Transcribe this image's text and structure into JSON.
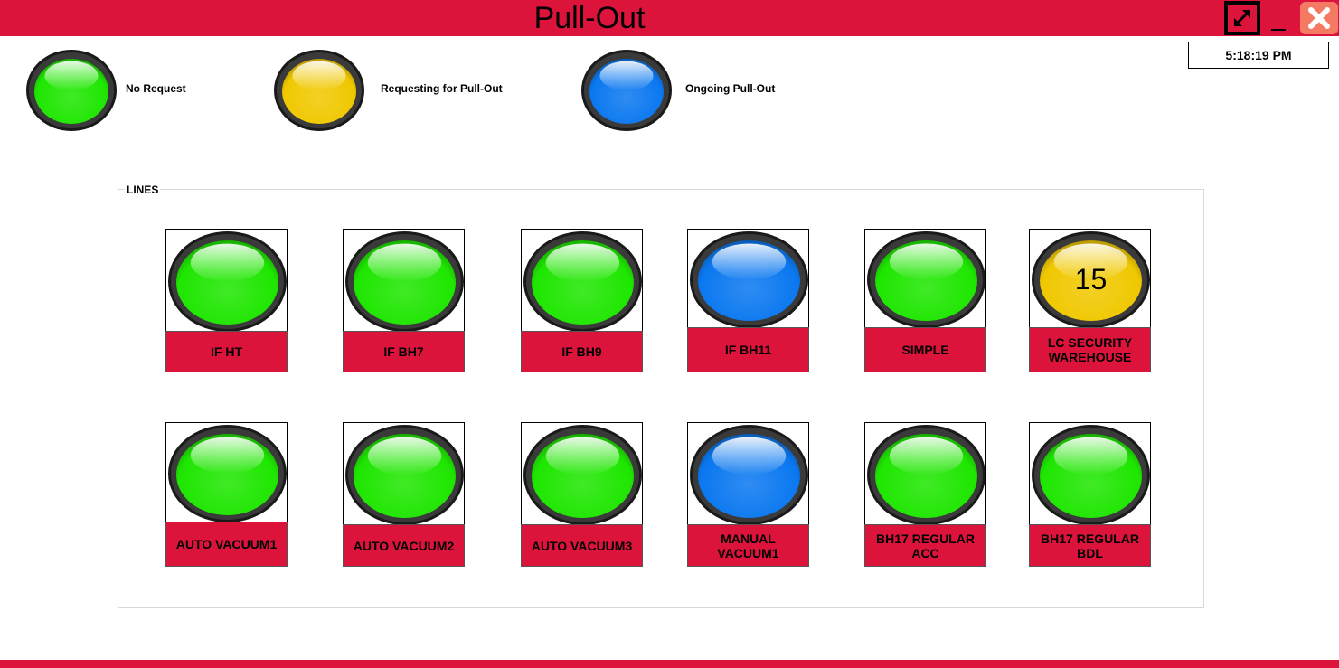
{
  "window": {
    "title": "Pull-Out",
    "clock": "5:18:19 PM"
  },
  "colors": {
    "brand_red": "#dc143c",
    "green": "#1ee600",
    "yellow": "#f0c800",
    "blue": "#0a78f0"
  },
  "icons": {
    "expand": "expand-arrows-icon",
    "minimize": "minimize-icon",
    "close": "close-x-icon"
  },
  "legend": [
    {
      "status": "green",
      "text": "No Request"
    },
    {
      "status": "yellow",
      "text": "Requesting for Pull-Out"
    },
    {
      "status": "blue",
      "text": "Ongoing Pull-Out"
    }
  ],
  "lines_group": {
    "label": "LINES",
    "lines": [
      {
        "name": "IF HT",
        "status": "green",
        "count": ""
      },
      {
        "name": "IF BH7",
        "status": "green",
        "count": ""
      },
      {
        "name": "IF BH9",
        "status": "green",
        "count": ""
      },
      {
        "name": "IF BH11",
        "status": "blue",
        "count": ""
      },
      {
        "name": "SIMPLE",
        "status": "green",
        "count": ""
      },
      {
        "name": "LC SECURITY WAREHOUSE",
        "status": "yellow",
        "count": "15"
      },
      {
        "name": "AUTO VACUUM1",
        "status": "green",
        "count": ""
      },
      {
        "name": "AUTO VACUUM2",
        "status": "green",
        "count": ""
      },
      {
        "name": "AUTO VACUUM3",
        "status": "green",
        "count": ""
      },
      {
        "name": "MANUAL VACUUM1",
        "status": "blue",
        "count": ""
      },
      {
        "name": "BH17 REGULAR ACC",
        "status": "green",
        "count": ""
      },
      {
        "name": "BH17 REGULAR BDL",
        "status": "green",
        "count": ""
      }
    ]
  }
}
